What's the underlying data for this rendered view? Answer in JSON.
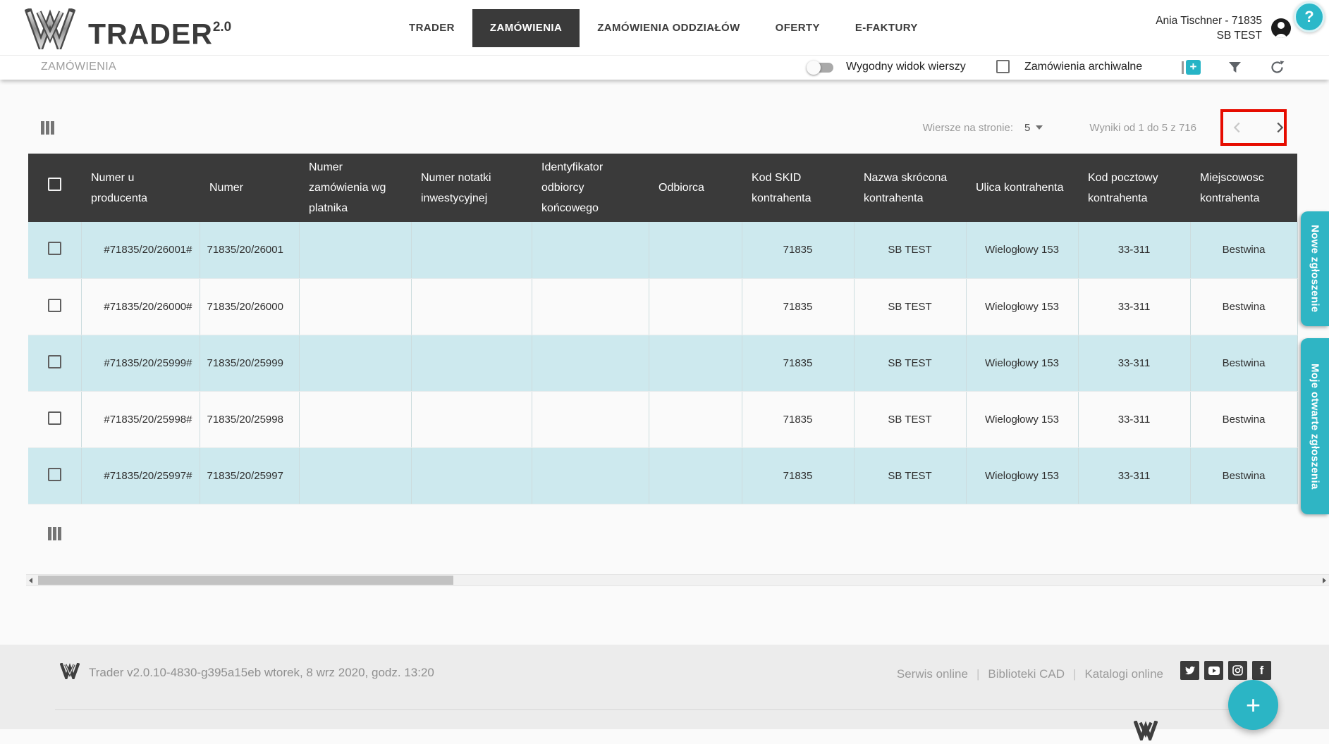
{
  "header": {
    "brand": {
      "name": "TRADER",
      "version": "2.0"
    },
    "nav": [
      {
        "label": "TRADER"
      },
      {
        "label": "ZAMÓWIENIA"
      },
      {
        "label": "ZAMÓWIENIA ODDZIAŁÓW"
      },
      {
        "label": "OFERTY"
      },
      {
        "label": "E-FAKTURY"
      }
    ],
    "user": {
      "name": "Ania Tischner - 71835",
      "company": "SB TEST"
    },
    "help_label": "?"
  },
  "toolbar": {
    "title": "ZAMÓWIENIA",
    "row_view_toggle_label": "Wygodny widok wierszy",
    "archive_checkbox_label": "Zamówienia archiwalne"
  },
  "pagination": {
    "rows_per_page_label": "Wiersze na stronie:",
    "rows_per_page_value": "5",
    "results_text": "Wyniki od 1 do 5 z 716"
  },
  "table": {
    "columns": [
      "Numer u producenta",
      "Numer",
      "Numer zamówienia wg platnika",
      "Numer notatki inwestycyjnej",
      "Identyfikator odbiorcy końcowego",
      "Odbiorca",
      "Kod SKID kontrahenta",
      "Nazwa skrócona kontrahenta",
      "Ulica kontrahenta",
      "Kod pocztowy kontrahenta",
      "Miejscowosc kontrahenta"
    ],
    "rows": [
      {
        "producer_number": "#71835/20/26001#",
        "number": "71835/20/26001",
        "skid_code": "71835",
        "short_name": "SB TEST",
        "street": "Wielogłowy 153",
        "postal_code": "33-311",
        "city": "Bestwina"
      },
      {
        "producer_number": "#71835/20/26000#",
        "number": "71835/20/26000",
        "skid_code": "71835",
        "short_name": "SB TEST",
        "street": "Wielogłowy 153",
        "postal_code": "33-311",
        "city": "Bestwina"
      },
      {
        "producer_number": "#71835/20/25999#",
        "number": "71835/20/25999",
        "skid_code": "71835",
        "short_name": "SB TEST",
        "street": "Wielogłowy 153",
        "postal_code": "33-311",
        "city": "Bestwina"
      },
      {
        "producer_number": "#71835/20/25998#",
        "number": "71835/20/25998",
        "skid_code": "71835",
        "short_name": "SB TEST",
        "street": "Wielogłowy 153",
        "postal_code": "33-311",
        "city": "Bestwina"
      },
      {
        "producer_number": "#71835/20/25997#",
        "number": "71835/20/25997",
        "skid_code": "71835",
        "short_name": "SB TEST",
        "street": "Wielogłowy 153",
        "postal_code": "33-311",
        "city": "Bestwina"
      }
    ]
  },
  "side_tabs": {
    "new_ticket": "Nowe zgłoszenie",
    "open_tickets": "Moje otwarte zgłoszenia"
  },
  "footer": {
    "version_text": "Trader v2.0.10-4830-g395a15eb wtorek, 8 wrz 2020, godz. 13:20",
    "links": [
      "Serwis online",
      "Biblioteki CAD",
      "Katalogi online"
    ],
    "social": [
      "twitter",
      "youtube",
      "instagram",
      "facebook"
    ],
    "fab_label": "+"
  },
  "colors": {
    "accent": "#2bb5c5",
    "table_header": "#3a3a3a",
    "row_highlight": "#cde9ee",
    "annotation_red": "#e60c00"
  }
}
